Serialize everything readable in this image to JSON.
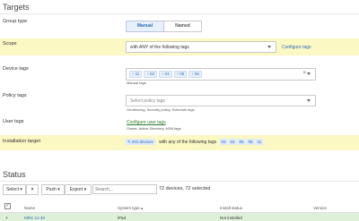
{
  "targets": {
    "title": "Targets",
    "group_type": {
      "label": "Group type",
      "options": [
        "Manual",
        "Named"
      ],
      "selected": "Manual"
    },
    "scope": {
      "label": "Scope",
      "value": "with ANY of the following tags",
      "link": "Configure tags"
    },
    "device_tags": {
      "label": "Device tags",
      "tags": [
        "11",
        "03",
        "04",
        "05",
        "06"
      ],
      "help": "Manual tags"
    },
    "policy_tags": {
      "label": "Policy tags",
      "placeholder": "Select policy tags",
      "help": "Geofencing, Security policy, Schedule tags"
    },
    "user_tags": {
      "label": "User tags",
      "link": "Configure user tags",
      "help": "Owner, Active Directory, ASM tags"
    },
    "installation_target": {
      "label": "Installation target",
      "devices": "iOS devices",
      "text": "with any of the following tags",
      "tags": [
        "03",
        "04",
        "05",
        "06",
        "11"
      ]
    }
  },
  "status": {
    "title": "Status",
    "select_label": "Select",
    "push_label": "Push",
    "export_label": "Export",
    "search_placeholder": "Search...",
    "count": "72 devices, 72 selected",
    "columns": [
      "Name",
      "System type",
      "Install status",
      "Version"
    ],
    "rows": [
      {
        "name": "MRC-11-48",
        "system_type": "iPad",
        "install_status": "Not installed"
      }
    ]
  },
  "colors": {
    "highlight": "#fbf8c4",
    "accent": "#2a6db5",
    "row_selected": "#dff0d8"
  },
  "icons": [
    "clear-x-icon",
    "caret-down-icon",
    "ios-apple-icon",
    "sort-asc-icon",
    "checkbox-icon"
  ]
}
